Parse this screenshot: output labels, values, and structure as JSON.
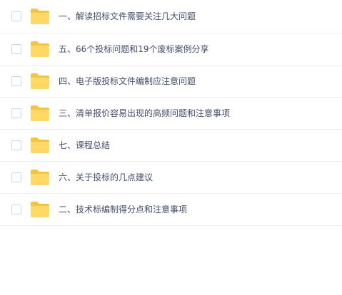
{
  "file_list": {
    "items": [
      {
        "name": "一、解读招标文件需要关注几大问题",
        "icon": "folder-icon"
      },
      {
        "name": "五、66个投标问题和19个废标案例分享",
        "icon": "folder-icon"
      },
      {
        "name": "四、电子版投标文件编制应注意问题",
        "icon": "folder-icon"
      },
      {
        "name": "三、清单报价容易出现的高频问题和注意事项",
        "icon": "folder-icon"
      },
      {
        "name": "七、课程总结",
        "icon": "folder-icon"
      },
      {
        "name": "六、关于投标的几点建议",
        "icon": "folder-icon"
      },
      {
        "name": "二、技术标编制得分点和注意事项",
        "icon": "folder-icon"
      }
    ]
  },
  "colors": {
    "folder_back": "#f5c343",
    "folder_front": "#ffd866",
    "text": "#424e67",
    "divider": "#eef0f3"
  }
}
